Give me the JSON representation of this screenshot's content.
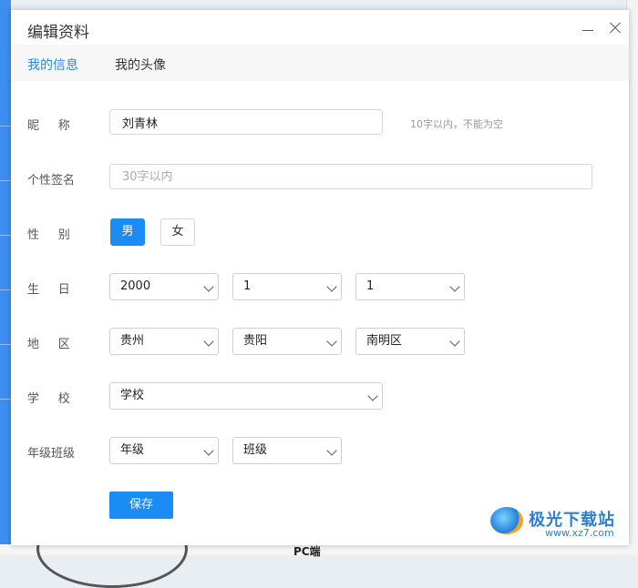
{
  "dialog": {
    "title": "编辑资料"
  },
  "tabs": [
    {
      "label": "我的信息",
      "active": true
    },
    {
      "label": "我的头像",
      "active": false
    }
  ],
  "form": {
    "nickname": {
      "label": "昵称",
      "value": "刘青林",
      "hint": "10字以内，不能为空"
    },
    "signature": {
      "label": "个性签名",
      "value": "",
      "placeholder": "30字以内"
    },
    "gender": {
      "label": "性别",
      "options": [
        "男",
        "女"
      ],
      "selected": "男"
    },
    "birthday": {
      "label": "生日",
      "year": "2000",
      "month": "1",
      "day": "1"
    },
    "region": {
      "label": "地区",
      "province": "贵州",
      "city": "贵阳",
      "district": "南明区"
    },
    "school": {
      "label": "学校",
      "value": "学校"
    },
    "grade_class": {
      "label": "年级班级",
      "grade": "年级",
      "class": "班级"
    },
    "save_label": "保存"
  },
  "background": {
    "bottom_text": "PC端"
  },
  "watermark": {
    "brand": "极光下载站",
    "url": "www.xz7.com"
  },
  "colors": {
    "accent": "#1c8cf5",
    "tab_active": "#2f88d6"
  }
}
